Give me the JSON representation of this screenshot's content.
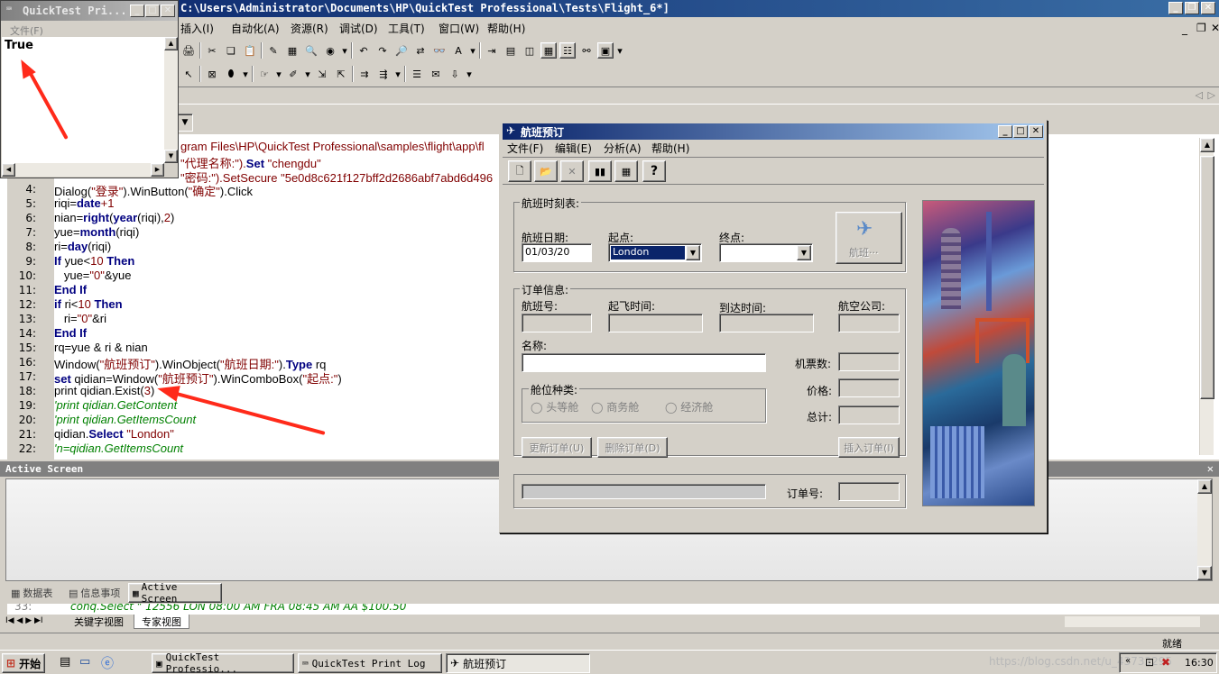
{
  "qtp": {
    "title": "C:\\Users\\Administrator\\Documents\\HP\\QuickTest Professional\\Tests\\Flight_6*]",
    "menu": [
      "插入(I)",
      "自动化(A)",
      "资源(R)",
      "调试(D)",
      "工具(T)",
      "窗口(W)",
      "帮助(H)"
    ]
  },
  "print_log": {
    "title": "QuickTest Pri...",
    "menu_file": "文件(F)",
    "output": "True"
  },
  "editor": {
    "path_fragment1": "gram Files\\HP\\QuickTest Professional\\samples\\flight\\app\\fl",
    "line2_fragment_a": "\"代理名称:\").",
    "line2_kw": "Set",
    "line2_str": " \"chengdu\"",
    "line3_fragment_a": "\"密码:\").SetSecure ",
    "line3_str": "\"5e0d8c621f127bff2d2686abf7abd6d496",
    "lines": [
      {
        "n": "4:",
        "parts": [
          {
            "t": "Dialog(",
            "c": ""
          },
          {
            "t": "\"登录\"",
            "c": "str"
          },
          {
            "t": ").WinButton(",
            "c": ""
          },
          {
            "t": "\"确定\"",
            "c": "str"
          },
          {
            "t": ").Click",
            "c": ""
          }
        ]
      },
      {
        "n": "5:",
        "parts": [
          {
            "t": "riqi=",
            "c": ""
          },
          {
            "t": "date",
            "c": "kw"
          },
          {
            "t": "+1",
            "c": "num"
          }
        ]
      },
      {
        "n": "6:",
        "parts": [
          {
            "t": "nian=",
            "c": ""
          },
          {
            "t": "right",
            "c": "kw"
          },
          {
            "t": "(",
            "c": ""
          },
          {
            "t": "year",
            "c": "kw"
          },
          {
            "t": "(riqi),",
            "c": ""
          },
          {
            "t": "2",
            "c": "num"
          },
          {
            "t": ")",
            "c": ""
          }
        ]
      },
      {
        "n": "7:",
        "parts": [
          {
            "t": "yue=",
            "c": ""
          },
          {
            "t": "month",
            "c": "kw"
          },
          {
            "t": "(riqi)",
            "c": ""
          }
        ]
      },
      {
        "n": "8:",
        "parts": [
          {
            "t": "ri=",
            "c": ""
          },
          {
            "t": "day",
            "c": "kw"
          },
          {
            "t": "(riqi)",
            "c": ""
          }
        ]
      },
      {
        "n": "9:",
        "parts": [
          {
            "t": "If",
            "c": "kw"
          },
          {
            "t": " yue<",
            "c": ""
          },
          {
            "t": "10",
            "c": "num"
          },
          {
            "t": " Then",
            "c": "kw"
          }
        ]
      },
      {
        "n": "10:",
        "parts": [
          {
            "t": "   yue=",
            "c": ""
          },
          {
            "t": "\"0\"",
            "c": "str"
          },
          {
            "t": "&yue",
            "c": ""
          }
        ]
      },
      {
        "n": "11:",
        "parts": [
          {
            "t": "End If",
            "c": "kw"
          }
        ]
      },
      {
        "n": "12:",
        "parts": [
          {
            "t": "if",
            "c": "kw"
          },
          {
            "t": " ri<",
            "c": ""
          },
          {
            "t": "10",
            "c": "num"
          },
          {
            "t": " Then",
            "c": "kw"
          }
        ]
      },
      {
        "n": "13:",
        "parts": [
          {
            "t": "   ri=",
            "c": ""
          },
          {
            "t": "\"0\"",
            "c": "str"
          },
          {
            "t": "&ri",
            "c": ""
          }
        ]
      },
      {
        "n": "14:",
        "parts": [
          {
            "t": "End If",
            "c": "kw"
          }
        ]
      },
      {
        "n": "15:",
        "parts": [
          {
            "t": "rq=yue & ri & nian",
            "c": ""
          }
        ]
      },
      {
        "n": "16:",
        "parts": [
          {
            "t": "Window(",
            "c": ""
          },
          {
            "t": "\"航班预订\"",
            "c": "str"
          },
          {
            "t": ").WinObject(",
            "c": ""
          },
          {
            "t": "\"航班日期:\"",
            "c": "str"
          },
          {
            "t": ").",
            "c": ""
          },
          {
            "t": "Type",
            "c": "kw"
          },
          {
            "t": " rq",
            "c": ""
          }
        ]
      },
      {
        "n": "17:",
        "parts": [
          {
            "t": "set",
            "c": "kw"
          },
          {
            "t": " qidian=Window(",
            "c": ""
          },
          {
            "t": "\"航班预订\"",
            "c": "str"
          },
          {
            "t": ").WinComboBox(",
            "c": ""
          },
          {
            "t": "\"起点:\"",
            "c": "str"
          },
          {
            "t": ")",
            "c": ""
          }
        ]
      },
      {
        "n": "18:",
        "parts": [
          {
            "t": "print qidian.Exist(",
            "c": ""
          },
          {
            "t": "3",
            "c": "num"
          },
          {
            "t": ")",
            "c": ""
          }
        ]
      },
      {
        "n": "19:",
        "parts": [
          {
            "t": "'print qidian.GetContent",
            "c": "cm"
          }
        ]
      },
      {
        "n": "20:",
        "parts": [
          {
            "t": "'print qidian.GetItemsCount",
            "c": "cm"
          }
        ]
      },
      {
        "n": "21:",
        "parts": [
          {
            "t": "qidian.",
            "c": ""
          },
          {
            "t": "Select",
            "c": "kw"
          },
          {
            "t": " ",
            "c": ""
          },
          {
            "t": "\"London\"",
            "c": "str"
          }
        ]
      },
      {
        "n": "22:",
        "parts": [
          {
            "t": "'n=qidian.GetItemsCount",
            "c": "cm"
          }
        ]
      }
    ],
    "line33": "conq.Select \"   12556  LON   08:00 AM  FRA   08:45 AM  AA    $100.50"
  },
  "active_screen": {
    "title": "Active Screen"
  },
  "bottom_tabs": [
    "数据表",
    "信息事项",
    "Active Screen"
  ],
  "view_tabs": [
    "关键字视图",
    "专家视图"
  ],
  "status": "就绪",
  "flight": {
    "title": "航班预订",
    "menu": [
      "文件(F)",
      "编辑(E)",
      "分析(A)",
      "帮助(H)"
    ],
    "schedule_group": "航班时刻表:",
    "date_label": "航班日期:",
    "date_value": "01/03/20",
    "from_label": "起点:",
    "from_value": "London",
    "to_label": "终点:",
    "flights_button": "航班···",
    "order_group": "订单信息:",
    "flight_no": "航班号:",
    "depart_time": "起飞时间:",
    "arrive_time": "到达时间:",
    "airline": "航空公司:",
    "name": "名称:",
    "tickets": "机票数:",
    "class_group": "舱位种类:",
    "classes": [
      "头等舱",
      "商务舱",
      "经济舱"
    ],
    "price": "价格:",
    "total": "总计:",
    "update_btn": "更新订单(U)",
    "delete_btn": "删除订单(D)",
    "insert_btn": "插入订单(I)",
    "order_no": "订单号:"
  },
  "taskbar": {
    "start": "开始",
    "tasks": [
      "QuickTest Professio...",
      "QuickTest Print Log",
      "航班预订"
    ],
    "watermark": "https://blog.csdn.net/u_43732295",
    "clock": "16:30"
  }
}
